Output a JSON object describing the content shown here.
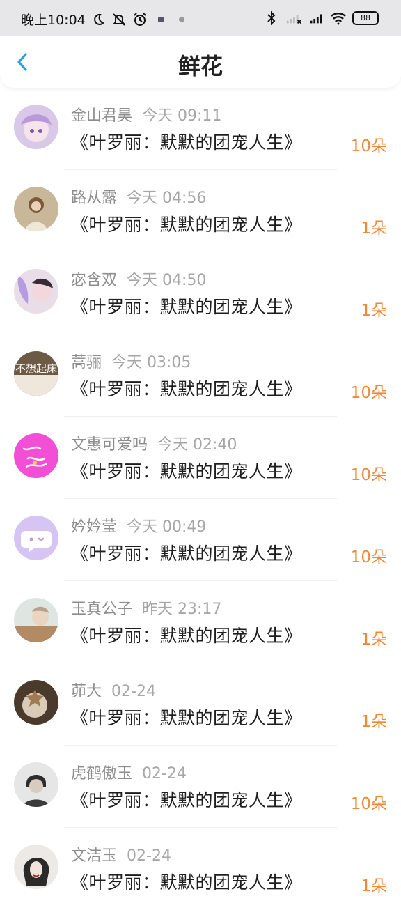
{
  "status_bar": {
    "time": "晚上10:04",
    "battery": "88"
  },
  "header": {
    "title": "鲜花"
  },
  "items": [
    {
      "user": "金山君昊",
      "time": "今天 09:11",
      "book": "《叶罗丽：默默的团宠人生》",
      "count": "10朵"
    },
    {
      "user": "路从露",
      "time": "今天 04:56",
      "book": "《叶罗丽：默默的团宠人生》",
      "count": "1朵"
    },
    {
      "user": "宓含双",
      "time": "今天 04:50",
      "book": "《叶罗丽：默默的团宠人生》",
      "count": "1朵"
    },
    {
      "user": "蒿骊",
      "time": "今天 03:05",
      "book": "《叶罗丽：默默的团宠人生》",
      "count": "10朵",
      "avatar_text": "不想起床"
    },
    {
      "user": "文惠可爱吗",
      "time": "今天 02:40",
      "book": "《叶罗丽：默默的团宠人生》",
      "count": "10朵"
    },
    {
      "user": "妗妗莹",
      "time": "今天 00:49",
      "book": "《叶罗丽：默默的团宠人生》",
      "count": "10朵"
    },
    {
      "user": "玉真公子",
      "time": "昨天 23:17",
      "book": "《叶罗丽：默默的团宠人生》",
      "count": "1朵"
    },
    {
      "user": "茆大",
      "time": "02-24",
      "book": "《叶罗丽：默默的团宠人生》",
      "count": "1朵"
    },
    {
      "user": "虎鹤傲玉",
      "time": "02-24",
      "book": "《叶罗丽：默默的团宠人生》",
      "count": "10朵"
    },
    {
      "user": "文洁玉",
      "time": "02-24",
      "book": "《叶罗丽：默默的团宠人生》",
      "count": "1朵"
    }
  ],
  "colors": {
    "accent_back": "#2aa0e0",
    "count_orange": "#f0883a"
  }
}
